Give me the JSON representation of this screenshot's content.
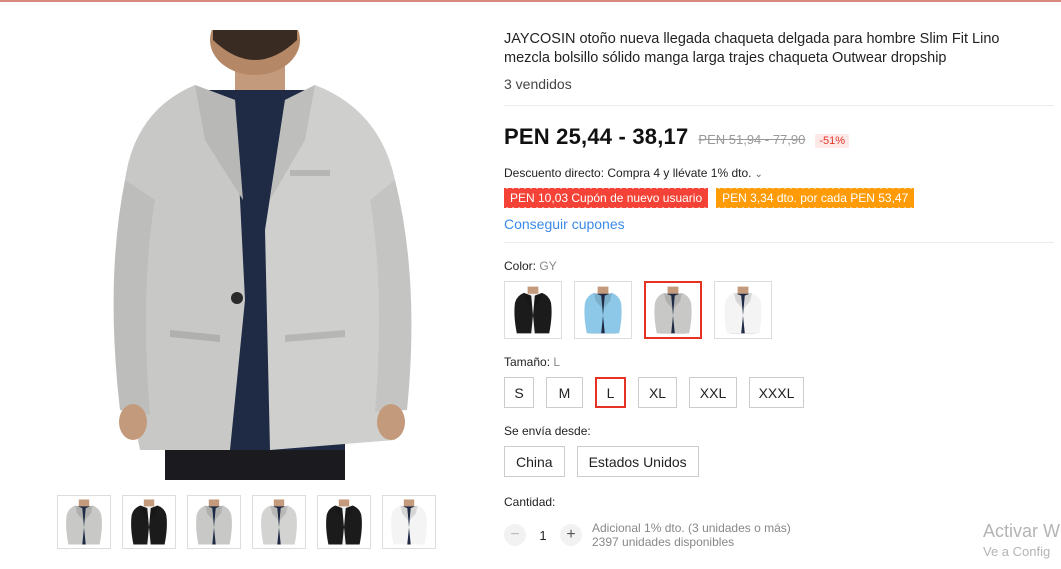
{
  "product": {
    "title": "JAYCOSIN otoño nueva llegada chaqueta delgada para hombre Slim Fit Lino mezcla bolsillo sólido manga larga trajes chaqueta Outwear dropship",
    "sold": "3 vendidos",
    "price": "PEN 25,44 - 38,17",
    "original_price": "PEN 51,94 - 77,90",
    "discount_pct": "-51%",
    "direct_discount": "Descuento directo: Compra 4 y llévate 1% dto.",
    "coupons": [
      "PEN 10,03 Cupón de nuevo usuario",
      "PEN 3,34 dto. por cada PEN 53,47"
    ],
    "get_coupons": "Conseguir cupones"
  },
  "color": {
    "label": "Color:",
    "selected": "GY",
    "options": [
      {
        "name": "black",
        "jacket": "#1b1b1b"
      },
      {
        "name": "light-blue",
        "jacket": "#8ec8e8"
      },
      {
        "name": "gray",
        "jacket": "#c8c9c6",
        "selected": true
      },
      {
        "name": "white",
        "jacket": "#f4f4f4"
      }
    ]
  },
  "size": {
    "label": "Tamaño:",
    "selected": "L",
    "options": [
      "S",
      "M",
      "L",
      "XL",
      "XXL",
      "XXXL"
    ]
  },
  "shipping": {
    "label": "Se envía desde:",
    "options": [
      "China",
      "Estados Unidos"
    ]
  },
  "quantity": {
    "label": "Cantidad:",
    "minus": "−",
    "value": "1",
    "plus": "+",
    "note1": "Adicional 1% dto. (3 unidades o más)",
    "note2": "2397 unidades disponibles"
  },
  "gallery": {
    "thumbs": [
      {
        "name": "gray-front",
        "jacket": "#c8c9c6"
      },
      {
        "name": "black-front",
        "jacket": "#1b1b1b"
      },
      {
        "name": "gray-back",
        "jacket": "#c8c9c6"
      },
      {
        "name": "gray-flat",
        "jacket": "#d3d4d1"
      },
      {
        "name": "black-flat",
        "jacket": "#1b1b1b"
      },
      {
        "name": "white-flat",
        "jacket": "#f4f4f4"
      }
    ]
  },
  "watermark": {
    "line1": "Activar W",
    "line2": "Ve a Config"
  },
  "colors": {
    "accent": "#e43225",
    "coupon_red": "#f44336",
    "coupon_orange": "#ff9b06",
    "link": "#3b8ae8"
  },
  "icons": {
    "discount_chevron": "chevron-down-icon"
  }
}
